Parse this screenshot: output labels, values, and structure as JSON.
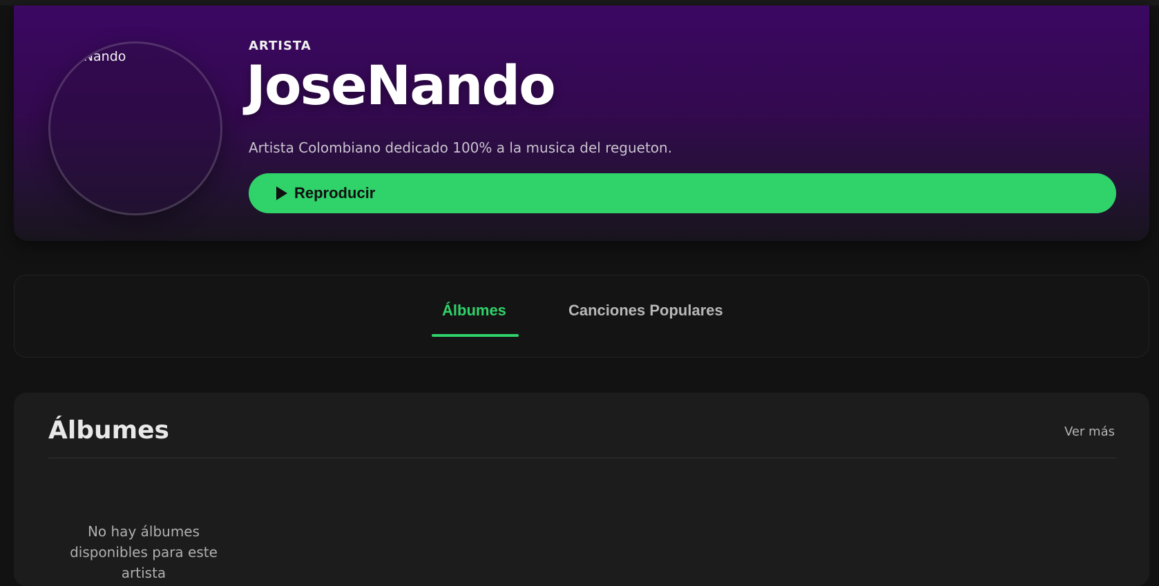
{
  "header": {
    "avatar_alt_text": "JoseNando",
    "eyebrow": "ARTISTA",
    "artist_name": "JoseNando",
    "bio": "Artista Colombiano dedicado 100% a la musica del regueton.",
    "play_label": "Reproducir",
    "play_icon": "play-icon"
  },
  "tabs": [
    {
      "label": "Álbumes",
      "active": true
    },
    {
      "label": "Canciones Populares",
      "active": false
    }
  ],
  "albums_section": {
    "title": "Álbumes",
    "see_more": "Ver más",
    "empty_message": "No hay álbumes disponibles para este artista"
  },
  "colors": {
    "accent": "#30d26a",
    "hero_top": "#3b0862",
    "background": "#121212",
    "card": "#1c1c1c"
  }
}
